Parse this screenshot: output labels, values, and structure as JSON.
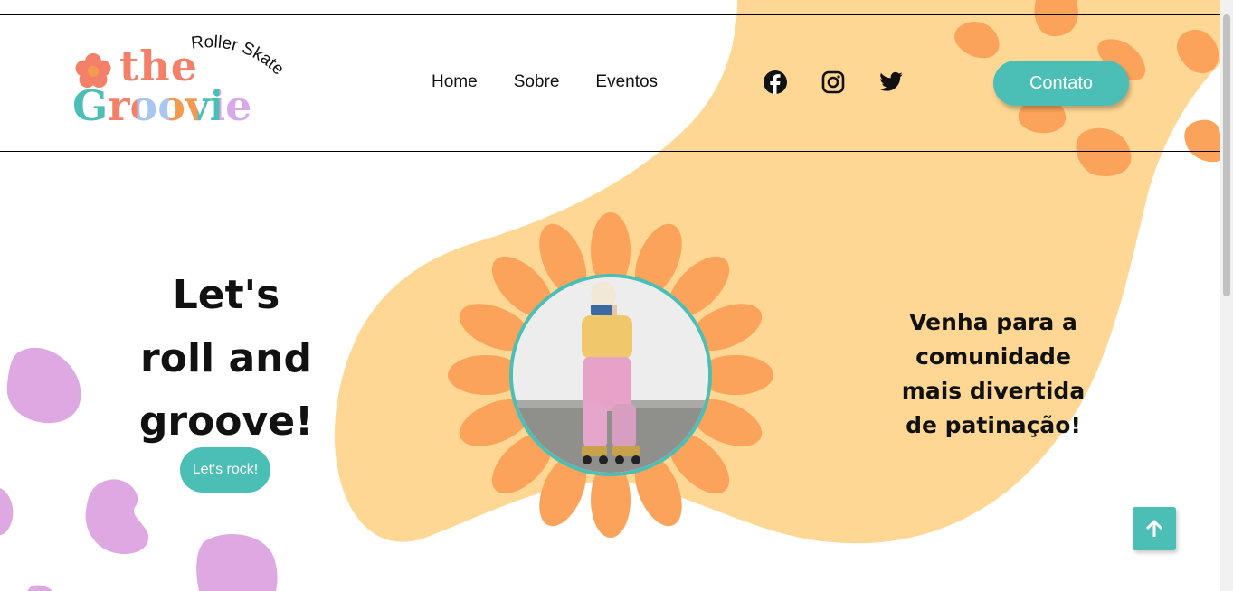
{
  "brand": {
    "word_the": "the",
    "word_groovie": "Groovie",
    "tagline_small": "Roller Skate",
    "colors": {
      "coral": "#f4806a",
      "blue": "#a7c7f0",
      "teal": "#4bbfb5",
      "lilac": "#d9a8e8",
      "orange": "#f49a50"
    }
  },
  "nav": {
    "items": [
      {
        "label": "Home"
      },
      {
        "label": "Sobre"
      },
      {
        "label": "Eventos"
      }
    ]
  },
  "social": {
    "icons": [
      "facebook-icon",
      "instagram-icon",
      "twitter-icon"
    ]
  },
  "header": {
    "contact_label": "Contato"
  },
  "hero": {
    "title_lines": [
      "Let's",
      "roll and",
      "groove!"
    ],
    "cta_label": "Let's rock!",
    "tagline_lines": [
      "Venha para a",
      "comunidade",
      "mais divertida",
      "de patinação!"
    ]
  },
  "back_to_top": {
    "icon": "arrow-up-icon"
  },
  "theme": {
    "accent": "#4bbfb5",
    "blob": "#fdd793",
    "petal": "#fba35a",
    "spots_orange": "#fba35a",
    "spots_purple": "#dea8e3"
  }
}
